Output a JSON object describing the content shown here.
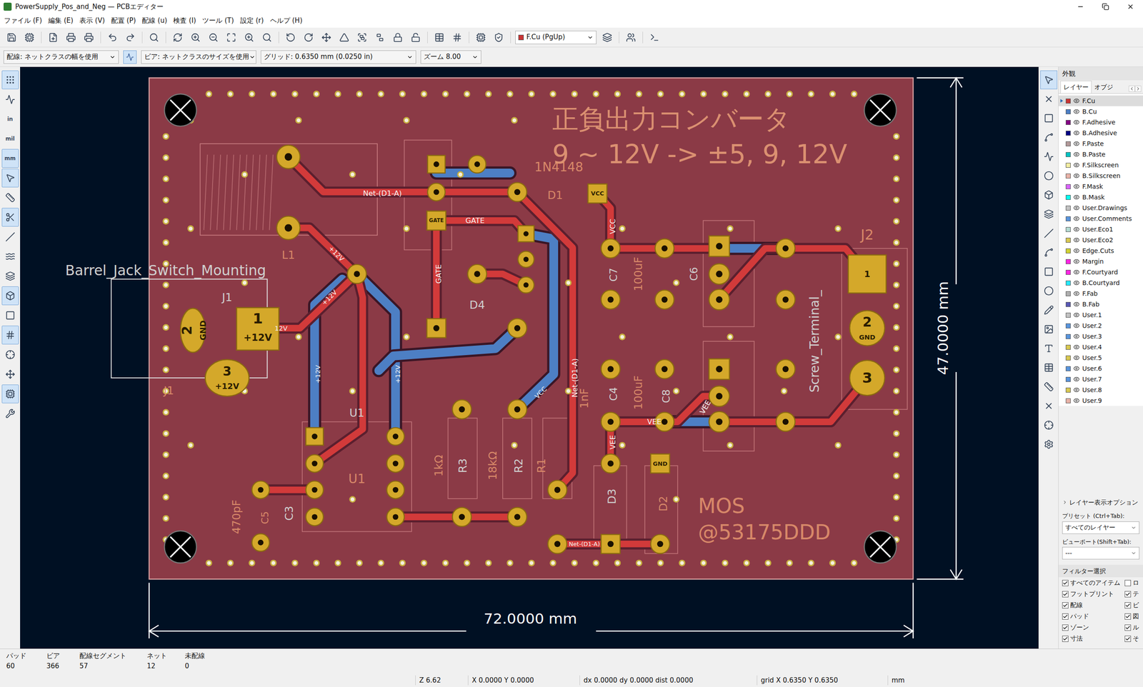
{
  "window": {
    "title": "PowerSupply_Pos_and_Neg — PCBエディター"
  },
  "menu": [
    "ファイル (F)",
    "編集 (E)",
    "表示 (V)",
    "配置 (P)",
    "配線 (u)",
    "検査 (I)",
    "ツール (T)",
    "設定 (r)",
    "ヘルプ (H)"
  ],
  "toolbar": {
    "layer_select": "F.Cu (PgUp)",
    "layer_color": "#c83434"
  },
  "options_bar": {
    "track": "配線: ネットクラスの幅を使用",
    "auto_width": {
      "selected": true
    },
    "via": "ビア: ネットクラスのサイズを使用",
    "grid": "グリッド: 0.6350 mm (0.0250 in)",
    "zoom": "ズーム 8.00"
  },
  "left_tools": [
    {
      "kind": "icon",
      "label": "",
      "selected": true
    },
    {
      "kind": "icon",
      "label": "",
      "selected": false
    },
    {
      "kind": "text",
      "label": "in",
      "selected": false
    },
    {
      "kind": "text",
      "label": "mil",
      "selected": false
    },
    {
      "kind": "text",
      "label": "mm",
      "selected": true
    },
    {
      "kind": "icon",
      "label": "",
      "selected": true
    },
    {
      "kind": "icon",
      "label": "",
      "selected": false
    },
    {
      "kind": "icon",
      "label": "",
      "selected": true
    },
    {
      "kind": "icon",
      "label": "",
      "selected": false
    },
    {
      "kind": "icon",
      "label": "",
      "selected": false
    },
    {
      "kind": "icon",
      "label": "",
      "selected": false
    },
    {
      "kind": "icon",
      "label": "",
      "selected": true
    },
    {
      "kind": "icon",
      "label": "",
      "selected": false
    },
    {
      "kind": "icon",
      "label": "",
      "selected": true
    },
    {
      "kind": "icon",
      "label": "",
      "selected": false
    },
    {
      "kind": "icon",
      "label": "",
      "selected": false
    },
    {
      "kind": "icon",
      "label": "",
      "selected": true
    },
    {
      "kind": "icon",
      "label": "",
      "selected": false
    }
  ],
  "right_tools": [
    {
      "selected": true
    },
    {
      "selected": false
    },
    {
      "selected": false
    },
    {
      "selected": false
    },
    {
      "selected": false
    },
    {
      "selected": false
    },
    {
      "selected": false
    },
    {
      "selected": false
    },
    {
      "selected": false
    },
    {
      "selected": false
    },
    {
      "selected": false
    },
    {
      "selected": false
    },
    {
      "selected": false
    },
    {
      "selected": false
    },
    {
      "selected": false
    },
    {
      "selected": false
    },
    {
      "selected": false
    },
    {
      "selected": false
    },
    {
      "selected": false
    },
    {
      "selected": false
    }
  ],
  "pcb": {
    "texts": [
      {
        "text": "正負出力コンバータ",
        "kind": "title"
      },
      {
        "text": "9 ~ 12V -> ±5, 9, 12V",
        "kind": "title"
      },
      {
        "text": "MOS",
        "kind": "silk"
      },
      {
        "text": "@53175DDD",
        "kind": "silk"
      },
      {
        "text": "72.0000 mm",
        "kind": "dim"
      },
      {
        "text": "47.0000 mm",
        "kind": "dim"
      },
      {
        "text": "Barrel_Jack_Switch_Mounting",
        "kind": "fab"
      },
      {
        "text": "J1",
        "kind": "fab"
      },
      {
        "text": "J1",
        "kind": "silk"
      },
      {
        "text": "J2",
        "kind": "silk"
      },
      {
        "text": "L1",
        "kind": "silk"
      },
      {
        "text": "U1",
        "kind": "fab"
      },
      {
        "text": "U1",
        "kind": "silk"
      },
      {
        "text": "1N4148",
        "kind": "silk"
      },
      {
        "text": "D1",
        "kind": "silk"
      },
      {
        "text": "D4",
        "kind": "fab"
      },
      {
        "text": "470pF",
        "kind": "silk"
      },
      {
        "text": "C5",
        "kind": "silk"
      },
      {
        "text": "C3",
        "kind": "fab"
      },
      {
        "text": "1kΩ",
        "kind": "silk"
      },
      {
        "text": "R3",
        "kind": "fab"
      },
      {
        "text": "18kΩ",
        "kind": "silk"
      },
      {
        "text": "R2",
        "kind": "fab"
      },
      {
        "text": "R1",
        "kind": "silk"
      },
      {
        "text": "D3",
        "kind": "fab"
      },
      {
        "text": "D2",
        "kind": "silk"
      },
      {
        "text": "1nF",
        "kind": "silk"
      },
      {
        "text": "C4",
        "kind": "fab"
      },
      {
        "text": "100uF",
        "kind": "silk"
      },
      {
        "text": "C8",
        "kind": "fab"
      },
      {
        "text": "C7",
        "kind": "fab"
      },
      {
        "text": "100uF",
        "kind": "silk"
      },
      {
        "text": "C6",
        "kind": "fab"
      },
      {
        "text": "Screw_Terminal_",
        "kind": "fab"
      },
      {
        "text": "Net-(D1-A)",
        "kind": "net"
      },
      {
        "text": "GATE",
        "kind": "net"
      },
      {
        "text": "GATE",
        "kind": "net"
      },
      {
        "text": "VCC",
        "kind": "net"
      },
      {
        "text": "+12V",
        "kind": "net"
      },
      {
        "text": "+12V",
        "kind": "net"
      },
      {
        "text": "12V",
        "kind": "net"
      },
      {
        "text": "VEE",
        "kind": "net"
      },
      {
        "text": "VEE",
        "kind": "net"
      },
      {
        "text": "Net-(D1-A)",
        "kind": "net"
      },
      {
        "text": "VCC",
        "kind": "net"
      },
      {
        "text": "+12V",
        "kind": "net"
      },
      {
        "text": "+12V",
        "kind": "net"
      },
      {
        "text": "Net-(D1-A)",
        "kind": "net"
      },
      {
        "text": "VEE",
        "kind": "net"
      },
      {
        "text": "2",
        "kind": "pad"
      },
      {
        "text": "GND",
        "kind": "pad"
      },
      {
        "text": "1",
        "kind": "pad"
      },
      {
        "text": "+12V",
        "kind": "pad"
      },
      {
        "text": "3",
        "kind": "pad"
      },
      {
        "text": "+12V",
        "kind": "pad"
      },
      {
        "text": "1",
        "kind": "pad"
      },
      {
        "text": "2",
        "kind": "pad"
      },
      {
        "text": "GND",
        "kind": "pad"
      },
      {
        "text": "3",
        "kind": "pad"
      },
      {
        "text": "GND",
        "kind": "pad"
      },
      {
        "text": "VCC",
        "kind": "pad"
      },
      {
        "text": "GATE",
        "kind": "pad"
      }
    ]
  },
  "appearance": {
    "title": "外観",
    "tabs": [
      {
        "label": "レイヤー",
        "selected": true
      },
      {
        "label": "オブジ",
        "selected": false
      }
    ],
    "layers": [
      {
        "name": "F.Cu",
        "color": "#c83434",
        "visible": true,
        "selected": true
      },
      {
        "name": "B.Cu",
        "color": "#4d7fc4",
        "visible": true,
        "selected": false
      },
      {
        "name": "F.Adhesive",
        "color": "#840084",
        "visible": true,
        "selected": false
      },
      {
        "name": "B.Adhesive",
        "color": "#000084",
        "visible": true,
        "selected": false
      },
      {
        "name": "F.Paste",
        "color": "#b29999",
        "visible": true,
        "selected": false
      },
      {
        "name": "B.Paste",
        "color": "#00c2c2",
        "visible": true,
        "selected": false
      },
      {
        "name": "F.Silkscreen",
        "color": "#f2eda1",
        "visible": true,
        "selected": false
      },
      {
        "name": "B.Silkscreen",
        "color": "#e8b2a7",
        "visible": true,
        "selected": false
      },
      {
        "name": "F.Mask",
        "color": "#d864ff",
        "visible": true,
        "selected": false
      },
      {
        "name": "B.Mask",
        "color": "#02ffee",
        "visible": true,
        "selected": false
      },
      {
        "name": "User.Drawings",
        "color": "#c2c2c2",
        "visible": true,
        "selected": false
      },
      {
        "name": "User.Comments",
        "color": "#5994dc",
        "visible": true,
        "selected": false
      },
      {
        "name": "User.Eco1",
        "color": "#b4dbd2",
        "visible": true,
        "selected": false
      },
      {
        "name": "User.Eco2",
        "color": "#d8c852",
        "visible": true,
        "selected": false
      },
      {
        "name": "Edge.Cuts",
        "color": "#d0d232",
        "visible": true,
        "selected": false
      },
      {
        "name": "Margin",
        "color": "#ff26e2",
        "visible": true,
        "selected": false
      },
      {
        "name": "F.Courtyard",
        "color": "#ff26e2",
        "visible": true,
        "selected": false
      },
      {
        "name": "B.Courtyard",
        "color": "#26e9ff",
        "visible": true,
        "selected": false
      },
      {
        "name": "F.Fab",
        "color": "#afafaf",
        "visible": true,
        "selected": false
      },
      {
        "name": "B.Fab",
        "color": "#5858b4",
        "visible": true,
        "selected": false
      },
      {
        "name": "User.1",
        "color": "#c2c2c2",
        "visible": true,
        "selected": false
      },
      {
        "name": "User.2",
        "color": "#5994dc",
        "visible": true,
        "selected": false
      },
      {
        "name": "User.3",
        "color": "#5994dc",
        "visible": true,
        "selected": false
      },
      {
        "name": "User.4",
        "color": "#d8c852",
        "visible": true,
        "selected": false
      },
      {
        "name": "User.5",
        "color": "#d8c852",
        "visible": true,
        "selected": false
      },
      {
        "name": "User.6",
        "color": "#5994dc",
        "visible": true,
        "selected": false
      },
      {
        "name": "User.7",
        "color": "#5994dc",
        "visible": true,
        "selected": false
      },
      {
        "name": "User.8",
        "color": "#d8c852",
        "visible": true,
        "selected": false
      },
      {
        "name": "User.9",
        "color": "#e8b2a7",
        "visible": true,
        "selected": false
      }
    ],
    "layer_options": {
      "label": "レイヤー表示オプション",
      "expanded": false
    },
    "preset": {
      "label": "プリセット (Ctrl+Tab):",
      "value": "すべてのレイヤー"
    },
    "viewport": {
      "label": "ビューポート(Shift+Tab):",
      "value": "---"
    },
    "filter": {
      "title": "フィルター選択",
      "items": [
        {
          "label": "すべてのアイテム",
          "checked": true
        },
        {
          "label": "ロ",
          "checked": false
        },
        {
          "label": "フットプリント",
          "checked": true
        },
        {
          "label": "テ",
          "checked": true
        },
        {
          "label": "配線",
          "checked": true
        },
        {
          "label": "ビ",
          "checked": true
        },
        {
          "label": "パッド",
          "checked": true
        },
        {
          "label": "図",
          "checked": true
        },
        {
          "label": "ゾーン",
          "checked": true
        },
        {
          "label": "ル",
          "checked": true
        },
        {
          "label": "寸法",
          "checked": true
        },
        {
          "label": "そ",
          "checked": true
        }
      ]
    }
  },
  "status": {
    "counts": [
      {
        "label": "パッド",
        "value": "60"
      },
      {
        "label": "ビア",
        "value": "366"
      },
      {
        "label": "配線セグメント",
        "value": "57"
      },
      {
        "label": "ネット",
        "value": "12"
      },
      {
        "label": "未配線",
        "value": "0"
      }
    ],
    "zoom": "Z 6.62",
    "cursor": "X 0.0000 Y 0.0000",
    "delta": "dx 0.0000 dy 0.0000 dist 0.0000",
    "grid": "grid X 0.6350 Y 0.6350",
    "units": "mm"
  }
}
